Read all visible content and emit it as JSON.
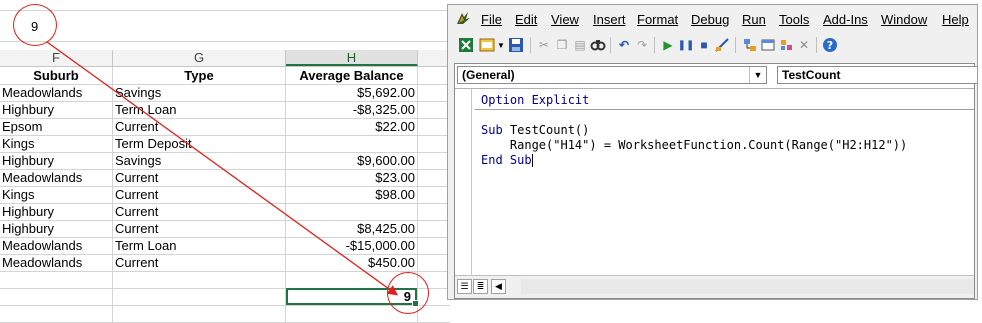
{
  "formula_bar": {
    "value": "9"
  },
  "columns": [
    "F",
    "G",
    "H"
  ],
  "table": {
    "headers": [
      "Suburb",
      "Type",
      "Average Balance"
    ],
    "rows": [
      [
        "Meadowlands",
        "Savings",
        "$5,692.00"
      ],
      [
        "Highbury",
        "Term Loan",
        "-$8,325.00"
      ],
      [
        "Epsom",
        "Current",
        "$22.00"
      ],
      [
        "Kings",
        "Term Deposit",
        ""
      ],
      [
        "Highbury",
        "Savings",
        "$9,600.00"
      ],
      [
        "Meadowlands",
        "Current",
        "$23.00"
      ],
      [
        "Kings",
        "Current",
        "$98.00"
      ],
      [
        "Highbury",
        "Current",
        ""
      ],
      [
        "Highbury",
        "Current",
        "$8,425.00"
      ],
      [
        "Meadowlands",
        "Term Loan",
        "-$15,000.00"
      ],
      [
        "Meadowlands",
        "Current",
        "$450.00"
      ]
    ],
    "count_result": "9"
  },
  "vbe": {
    "menus": [
      "File",
      "Edit",
      "View",
      "Insert",
      "Format",
      "Debug",
      "Run",
      "Tools",
      "Add-Ins",
      "Window",
      "Help"
    ],
    "combo_left": "(General)",
    "combo_right": "TestCount",
    "code": {
      "line1_kw": "Option Explicit",
      "line3_kw": "Sub",
      "line3_rest": " TestCount()",
      "line4": "    Range(\"H14\") = WorksheetFunction.Count(Range(\"H2:H12\"))",
      "line5_kw": "End Sub"
    }
  },
  "annotation_color": "#e02020",
  "excel_accent": "#217346"
}
